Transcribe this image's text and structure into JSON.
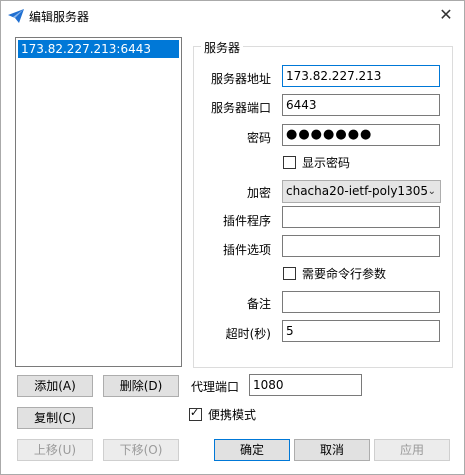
{
  "window": {
    "title": "编辑服务器",
    "close_glyph": "✕"
  },
  "server_list": {
    "items": [
      "173.82.227.213:6443"
    ]
  },
  "group": {
    "title": "服务器"
  },
  "form": {
    "address_label": "服务器地址",
    "address_value": "173.82.227.213",
    "port_label": "服务器端口",
    "port_value": "6443",
    "password_label": "密码",
    "password_value": "●●●●●●●",
    "show_password_label": "显示密码",
    "encryption_label": "加密",
    "encryption_value": "chacha20-ietf-poly1305",
    "plugin_label": "插件程序",
    "plugin_value": "",
    "plugin_options_label": "插件选项",
    "plugin_options_value": "",
    "need_cmd_args_label": "需要命令行参数",
    "remarks_label": "备注",
    "remarks_value": "",
    "timeout_label": "超时(秒)",
    "timeout_value": "5"
  },
  "buttons": {
    "add": "添加(A)",
    "delete": "删除(D)",
    "copy": "复制(C)",
    "move_up": "上移(U)",
    "move_down": "下移(O)",
    "ok": "确定",
    "cancel": "取消",
    "apply": "应用"
  },
  "proxy": {
    "label": "代理端口",
    "value": "1080"
  },
  "portable": {
    "label": "便携模式",
    "checked": true
  },
  "colors": {
    "selection": "#0078d7",
    "app_icon": "#1f6fd1"
  },
  "icons": {
    "app": "paper-plane-icon",
    "close": "close-icon",
    "dropdown": "chevron-down-icon"
  }
}
